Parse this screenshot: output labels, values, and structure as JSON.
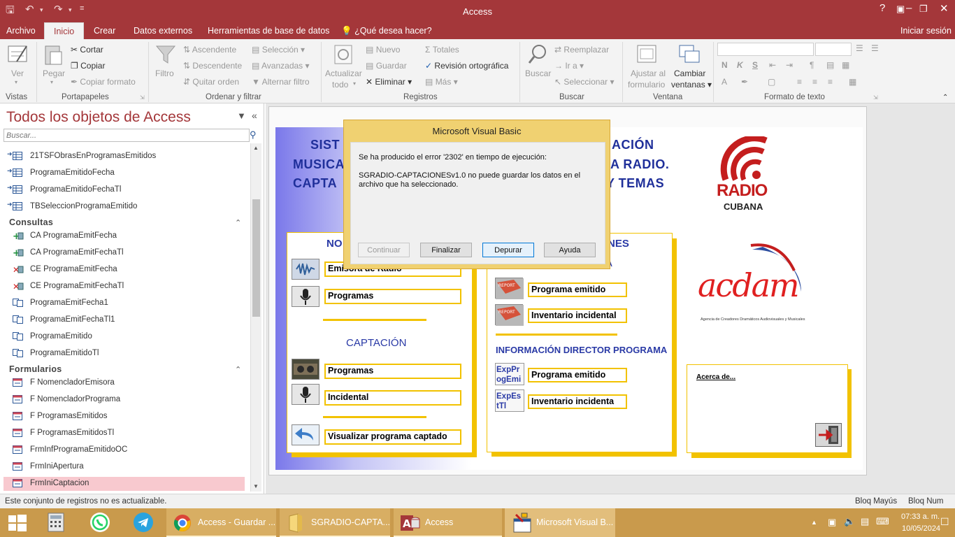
{
  "window": {
    "title": "Access"
  },
  "menu_tabs": [
    "Archivo",
    "Inicio",
    "Crear",
    "Datos externos",
    "Herramientas de base de datos"
  ],
  "tell_me": "¿Qué desea hacer?",
  "signin": "Iniciar sesión",
  "ribbon": {
    "vistas": {
      "ver": "Ver",
      "group": "Vistas"
    },
    "portapapeles": {
      "pegar": "Pegar",
      "cortar": "Cortar",
      "copiar": "Copiar",
      "copiar_formato": "Copiar formato",
      "group": "Portapapeles"
    },
    "ordenar": {
      "filtro": "Filtro",
      "ascendente": "Ascendente",
      "descendente": "Descendente",
      "quitar_orden": "Quitar orden",
      "seleccion": "Selección",
      "avanzadas": "Avanzadas",
      "alternar_filtro": "Alternar filtro",
      "group": "Ordenar y filtrar"
    },
    "registros": {
      "actualizar": "Actualizar",
      "todo": "todo",
      "nuevo": "Nuevo",
      "guardar": "Guardar",
      "eliminar": "Eliminar",
      "totales": "Totales",
      "revision": "Revisión ortográfica",
      "mas": "Más",
      "group": "Registros"
    },
    "buscar": {
      "buscar": "Buscar",
      "reemplazar": "Reemplazar",
      "ir_a": "Ir a",
      "seleccionar": "Seleccionar",
      "group": "Buscar"
    },
    "ventana": {
      "ajustar": "Ajustar al",
      "formulario": "formulario",
      "cambiar": "Cambiar",
      "ventanas": "ventanas",
      "group": "Ventana"
    },
    "formato": {
      "bold": "N",
      "italic": "K",
      "underline": "S",
      "group": "Formato de texto"
    }
  },
  "nav": {
    "header": "Todos los objetos de Access",
    "search_placeholder": "Buscar...",
    "tables": [
      "21TSFObrasEnProgramasEmitidos",
      "ProgramaEmitidoFecha",
      "ProgramaEmitidoFechaTl",
      "TBSeleccionProgramaEmitido"
    ],
    "consultas_label": "Consultas",
    "consultas": [
      {
        "label": "CA ProgramaEmitFecha",
        "kind": "append"
      },
      {
        "label": "CA ProgramaEmitFechaTl",
        "kind": "append"
      },
      {
        "label": "CE ProgramaEmitFecha",
        "kind": "delete"
      },
      {
        "label": "CE ProgramaEmitFechaTl",
        "kind": "delete"
      },
      {
        "label": "ProgramaEmitFecha1",
        "kind": "select"
      },
      {
        "label": "ProgramaEmitFechaTl1",
        "kind": "select"
      },
      {
        "label": "ProgramaEmitido",
        "kind": "select"
      },
      {
        "label": "ProgramaEmitidoTl",
        "kind": "select"
      }
    ],
    "formularios_label": "Formularios",
    "formularios": [
      "F NomencladorEmisora",
      "F NomencladorPrograma",
      "F ProgramasEmitidos",
      "F ProgramasEmitidosTl",
      "FrmInfProgramaEmitidoOC",
      "FrmIniApertura",
      "FrmIniCaptacion"
    ],
    "selected": "FrmIniCaptacion"
  },
  "form": {
    "title_lines": [
      "SIST",
      "MUSICA",
      "CAPTA"
    ],
    "title_right": [
      "ACIÓN",
      "A RADIO.",
      "Y TEMAS"
    ],
    "left_panel": {
      "heading": "NO",
      "buttons1": [
        "Emisora de Radio",
        "Programas"
      ],
      "captacion_heading": "CAPTACIÓN",
      "buttons2": [
        "Programas",
        "Incidental"
      ],
      "visualizar": "Visualizar programa captado"
    },
    "middle_panel": {
      "heading": "NES",
      "heading2": "A",
      "buttons1": [
        "Programa emitido",
        "Inventario incidental"
      ],
      "info_heading": "INFORMACIÓN DIRECTOR PROGRAMA",
      "exp_labels": [
        "ExpPr ogEmi",
        "ExpEs tTl"
      ],
      "buttons2": [
        "Programa emitido",
        "Inventario incidenta"
      ]
    },
    "radio_logo": {
      "line1": "RADIO",
      "line2": "CUBANA"
    },
    "acdam_logo": {
      "text": "acdam",
      "caption": "Agencia de Creadores Dramáticos Audiovisuales y Musicales"
    },
    "acerca": "Acerca de..."
  },
  "dialog": {
    "title": "Microsoft Visual Basic",
    "message1": "Se ha producido el error '2302' en tiempo de ejecución:",
    "message2": "SGRADIO-CAPTACIONESv1.0 no puede guardar los datos en el archivo que ha seleccionado.",
    "buttons": [
      "Continuar",
      "Finalizar",
      "Depurar",
      "Ayuda"
    ]
  },
  "status": {
    "left": "Este conjunto de registros no es actualizable.",
    "caps": "Bloq Mayús",
    "num": "Bloq Num"
  },
  "taskbar": {
    "apps": [
      "Access - Guardar ...",
      "SGRADIO-CAPTA...",
      "Access",
      "Microsoft Visual B..."
    ],
    "time": "07:33 a. m.",
    "date": "10/05/2024"
  },
  "colors": {
    "access_red": "#a4373a",
    "taskbar": "#c99a4c",
    "dialog": "#f0d171",
    "accent_yellow": "#f2c200",
    "form_blue": "#1f2f9a"
  }
}
